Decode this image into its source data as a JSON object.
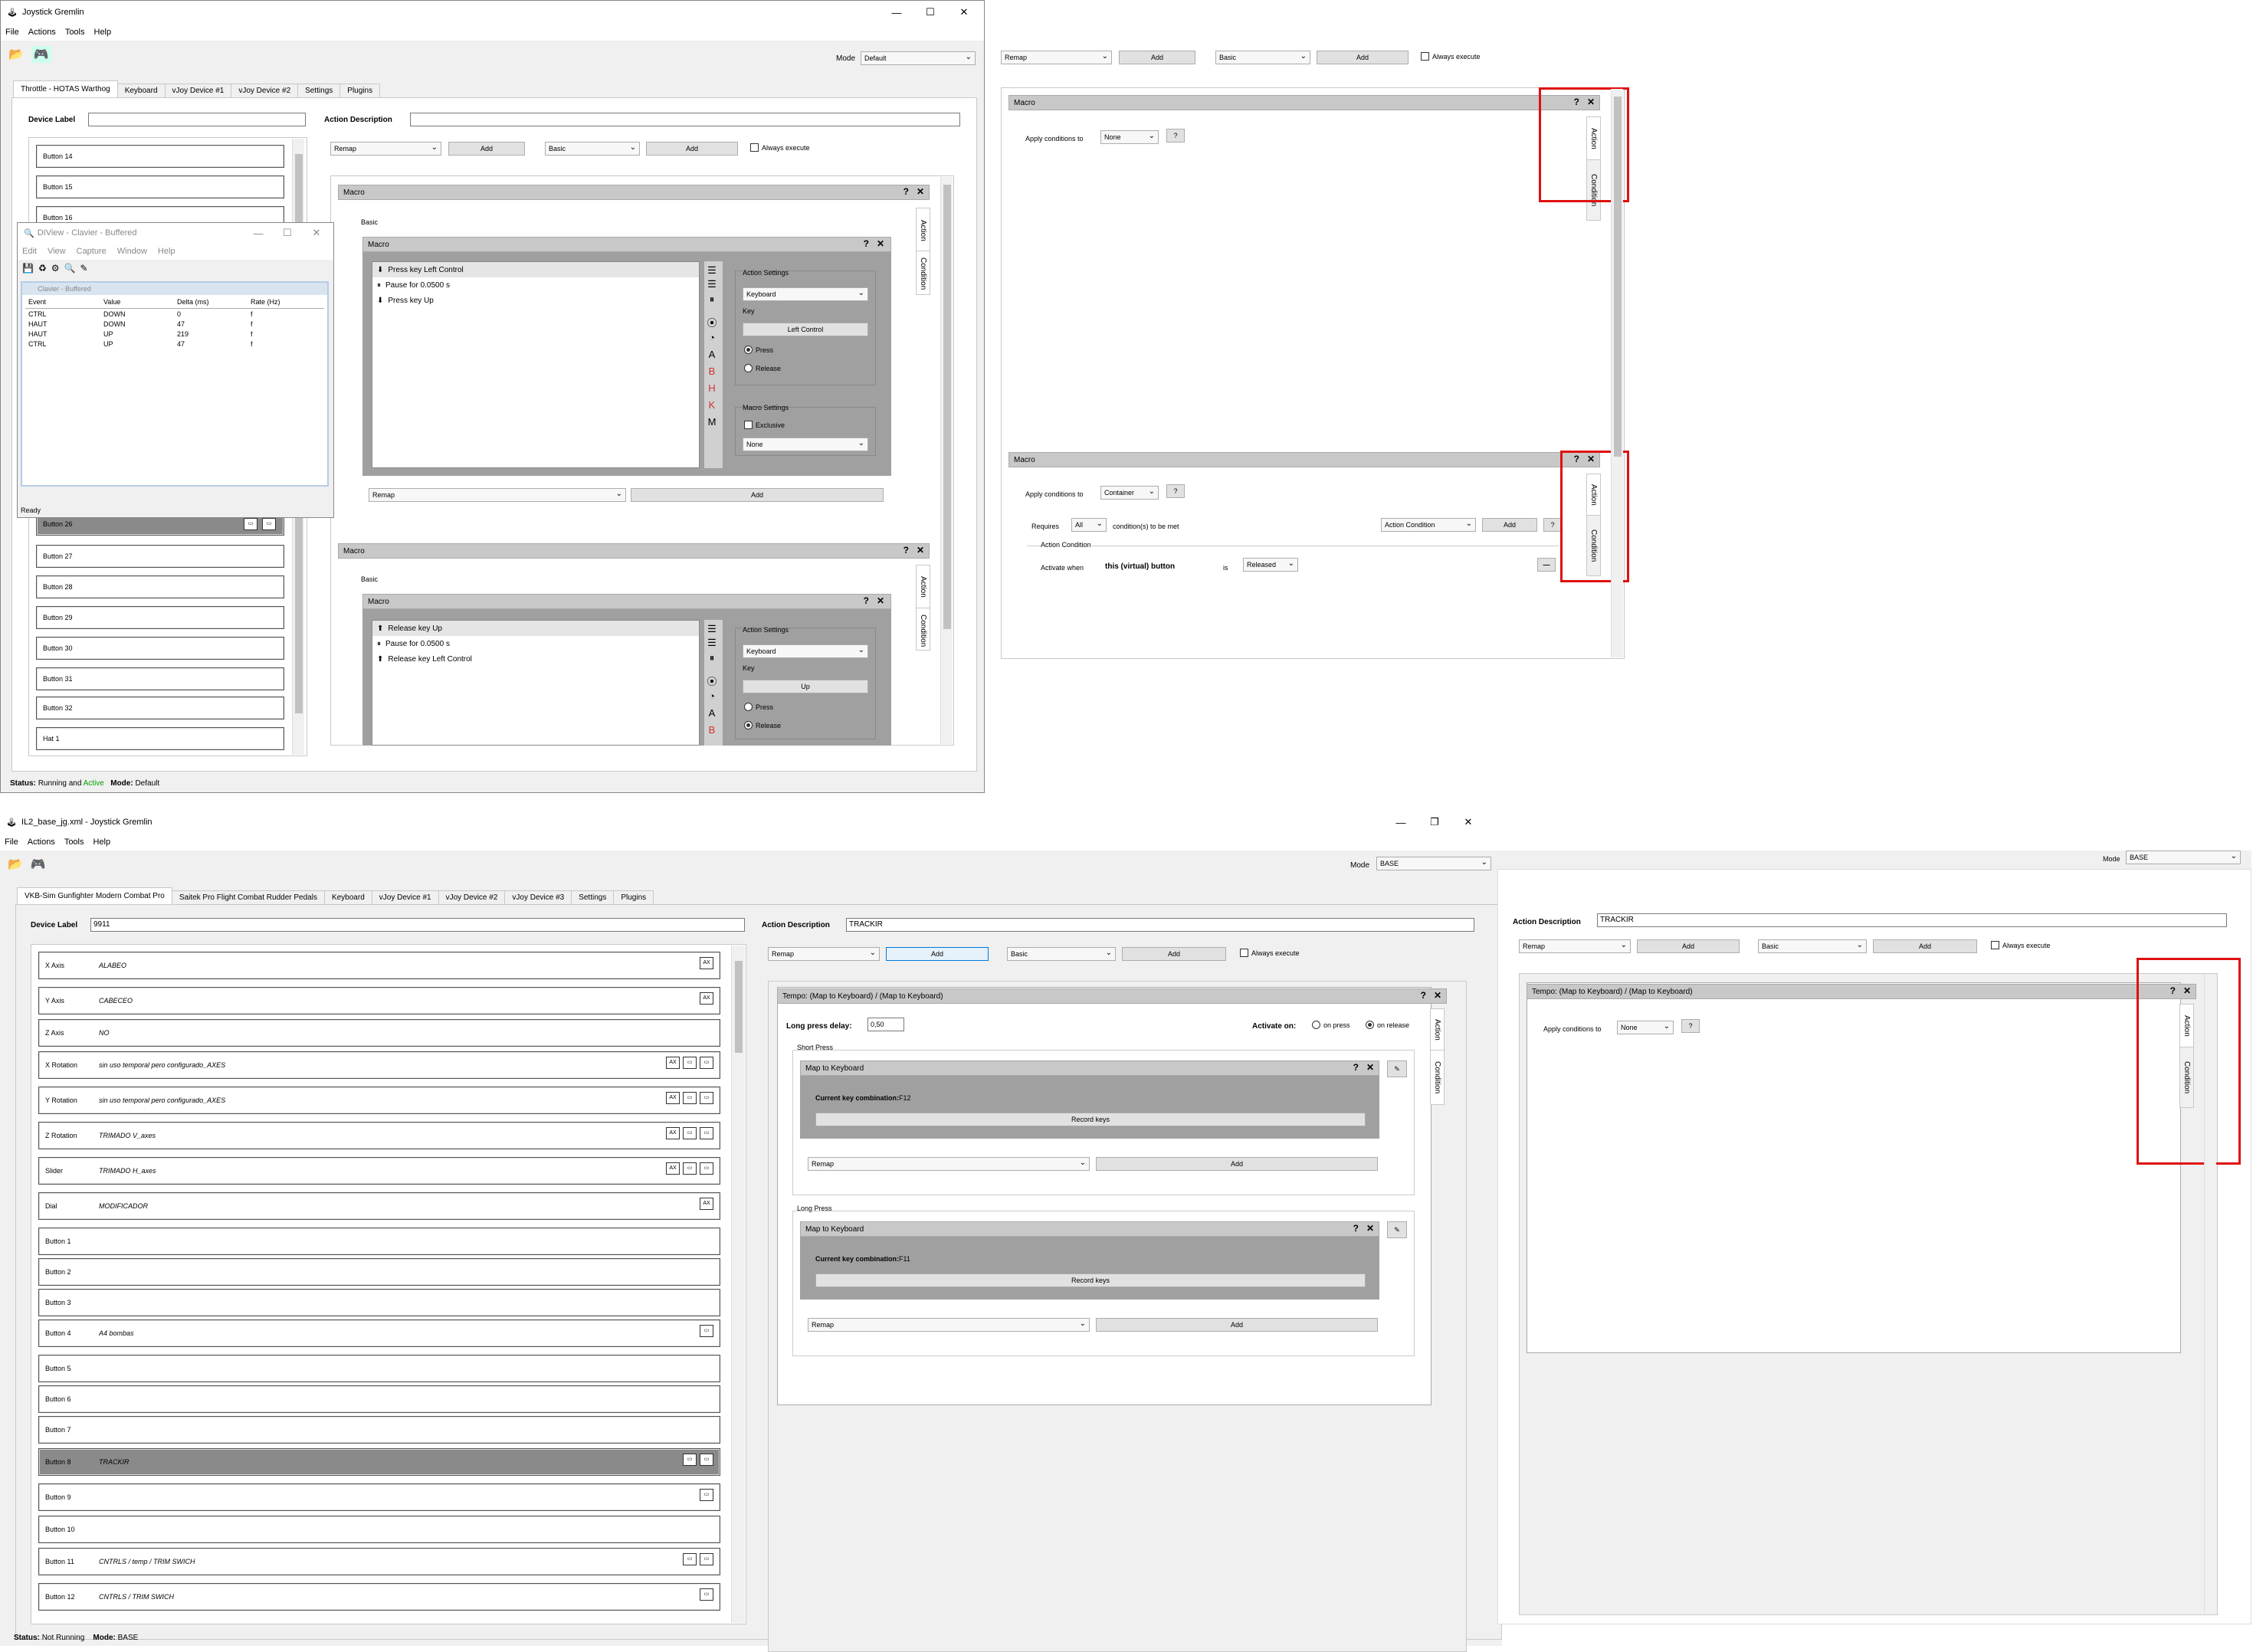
{
  "win1": {
    "title": "Joystick Gremlin",
    "menu": [
      "File",
      "Actions",
      "Tools",
      "Help"
    ],
    "mode_label": "Mode",
    "mode_value": "Default",
    "tabs": [
      "Throttle - HOTAS Warthog",
      "Keyboard",
      "vJoy Device #1",
      "vJoy Device #2",
      "Settings",
      "Plugins"
    ],
    "device_label": "Device Label",
    "action_description": "Action Description",
    "buttons_top": [
      "Button 14",
      "Button 15",
      "Button 16"
    ],
    "buttons_bottom": [
      "Button 26",
      "Button 27",
      "Button 28",
      "Button 29",
      "Button 30",
      "Button 31",
      "Button 32",
      "Hat 1"
    ],
    "remap": "Remap",
    "add": "Add",
    "basic": "Basic",
    "always_execute": "Always execute",
    "macro": "Macro",
    "basic_label": "Basic",
    "action_tab": "Action",
    "condition_tab": "Condition",
    "macro1_items": [
      "Press key Left Control",
      "Pause for 0.0500 s",
      "Press key Up"
    ],
    "macro2_items": [
      "Release key Up",
      "Pause for 0.0500 s",
      "Release key Left Control"
    ],
    "action_settings": "Action Settings",
    "keyboard": "Keyboard",
    "key": "Key",
    "key1": "Left Control",
    "key2": "Up",
    "press": "Press",
    "release": "Release",
    "macro_settings": "Macro Settings",
    "exclusive": "Exclusive",
    "none": "None",
    "letters": [
      "A",
      "B",
      "H",
      "K",
      "M"
    ],
    "status_label": "Status:",
    "status_text": "Running and",
    "status_active": "Active",
    "mode_status_label": "Mode:",
    "mode_status": "Default"
  },
  "dview": {
    "title": "DIView - Clavier - Buffered",
    "menu": [
      "Edit",
      "View",
      "Capture",
      "Window",
      "Help"
    ],
    "inner_title": "Clavier - Buffered",
    "headers": [
      "Event",
      "Value",
      "Delta (ms)",
      "Rate (Hz)"
    ],
    "rows": [
      [
        "CTRL",
        "DOWN",
        "0",
        "f"
      ],
      [
        "HAUT",
        "DOWN",
        "47",
        "f"
      ],
      [
        "HAUT",
        "UP",
        "219",
        "f"
      ],
      [
        "CTRL",
        "UP",
        "47",
        "f"
      ]
    ],
    "status": "Ready"
  },
  "topright": {
    "remap": "Remap",
    "add": "Add",
    "basic": "Basic",
    "always_execute": "Always execute",
    "macro": "Macro",
    "apply_conditions": "Apply conditions to",
    "none": "None",
    "container": "Container",
    "requires": "Requires",
    "all": "All",
    "conditions_met": "condition(s) to be met",
    "action_condition": "Action Condition",
    "add2": "Add",
    "activate_when": "Activate when",
    "this_button": "this (virtual) button",
    "is": "is",
    "released": "Released",
    "action_tab": "Action",
    "condition_tab": "Condition"
  },
  "win2": {
    "title": "IL2_base_jg.xml - Joystick Gremlin",
    "menu": [
      "File",
      "Actions",
      "Tools",
      "Help"
    ],
    "mode_label": "Mode",
    "mode_value": "BASE",
    "tabs": [
      "VKB-Sim Gunfighter Modern Combat Pro",
      "Saitek Pro Flight Combat Rudder Pedals",
      "Keyboard",
      "vJoy Device #1",
      "vJoy Device #2",
      "vJoy Device #3",
      "Settings",
      "Plugins"
    ],
    "device_label": "Device Label",
    "device_value": "9911",
    "action_description": "Action Description",
    "action_value": "TRACKIR",
    "inputs": [
      [
        "X Axis",
        "ALABEO"
      ],
      [
        "Y Axis",
        "CABECEO"
      ],
      [
        "Z Axis",
        "NO"
      ],
      [
        "X Rotation",
        "sin uso temporal pero configurado_AXES"
      ],
      [
        "Y Rotation",
        "sin uso temporal pero configurado_AXES"
      ],
      [
        "Z Rotation",
        "TRIMADO V_axes"
      ],
      [
        "Slider",
        "TRIMADO H_axes"
      ],
      [
        "Dial",
        "MODIFICADOR"
      ],
      [
        "Button 1",
        ""
      ],
      [
        "Button 2",
        ""
      ],
      [
        "Button 3",
        ""
      ],
      [
        "Button 4",
        "A4 bombas"
      ],
      [
        "Button 5",
        ""
      ],
      [
        "Button 6",
        ""
      ],
      [
        "Button 7",
        ""
      ],
      [
        "Button 8",
        "TRACKIR"
      ],
      [
        "Button 9",
        ""
      ],
      [
        "Button 10",
        ""
      ],
      [
        "Button 11",
        "CNTRLS / temp / TRIM SWICH"
      ],
      [
        "Button 12",
        "CNTRLS / TRIM SWICH"
      ]
    ],
    "remap": "Remap",
    "add": "Add",
    "basic": "Basic",
    "always_execute": "Always execute",
    "tempo": "Tempo: (Map to Keyboard) / (Map to Keyboard)",
    "long_press_delay": "Long press delay:",
    "delay_value": "0,50",
    "activate_on": "Activate on:",
    "on_press": "on press",
    "on_release": "on release",
    "short_press": "Short Press",
    "long_press": "Long Press",
    "map_to_keyboard": "Map to Keyboard",
    "current_combo": "Current key combination:",
    "combo1": "F12",
    "combo2": "F11",
    "record_keys": "Record keys",
    "action_tab": "Action",
    "condition_tab": "Condition",
    "status_label": "Status:",
    "status_text": "Not Running",
    "mode_status_label": "Mode:",
    "mode_status": "BASE"
  },
  "bottomright": {
    "mode_label": "Mode",
    "mode_value": "BASE",
    "action_description": "Action Description",
    "action_value": "TRACKIR",
    "remap": "Remap",
    "add": "Add",
    "basic": "Basic",
    "always_execute": "Always execute",
    "tempo": "Tempo: (Map to Keyboard) / (Map to Keyboard)",
    "apply_conditions": "Apply conditions to",
    "none": "None",
    "action_tab": "Action",
    "condition_tab": "Condition"
  },
  "colors": {
    "highlight": "#e01010",
    "active_green": "#00a000",
    "selected_dark": "#8a8a8a"
  }
}
